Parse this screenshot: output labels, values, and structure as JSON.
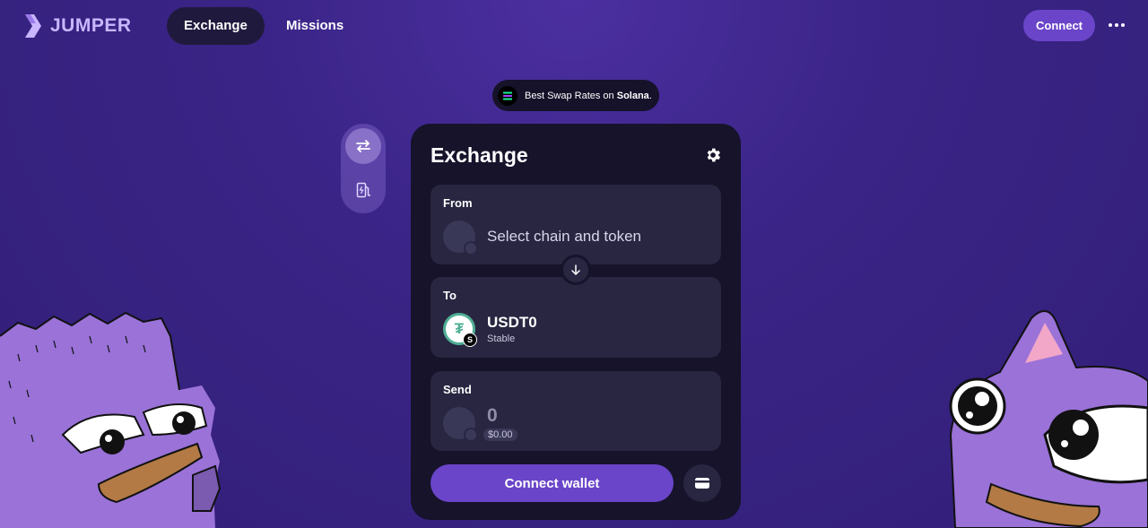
{
  "header": {
    "brand": "JUMPER",
    "nav": [
      {
        "label": "Exchange",
        "active": true
      },
      {
        "label": "Missions",
        "active": false
      }
    ],
    "connect_label": "Connect"
  },
  "banner": {
    "prefix": "Best Swap Rates on ",
    "highlight": "Solana",
    "suffix": "."
  },
  "rail": {
    "items": [
      {
        "icon": "swap-arrows-icon",
        "active": true
      },
      {
        "icon": "gas-pump-icon",
        "active": false
      }
    ]
  },
  "widget": {
    "title": "Exchange",
    "from": {
      "label": "From",
      "placeholder": "Select chain and token"
    },
    "to": {
      "label": "To",
      "token_symbol": "USDT0",
      "token_subtitle": "Stable",
      "token_icon": "usdt-icon",
      "chain_icon": "chain-badge-icon"
    },
    "send": {
      "label": "Send",
      "amount": "0",
      "usd_value": "$0.00"
    },
    "connect_wallet_label": "Connect wallet"
  },
  "colors": {
    "accent": "#6a45c9",
    "card": "#16132b",
    "panel": "#282641",
    "usdt_green": "#50af95"
  }
}
